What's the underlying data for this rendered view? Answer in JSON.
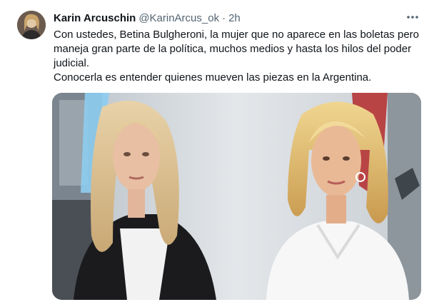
{
  "tweet": {
    "author_name": "Karin Arcuschin",
    "handle": "@KarinArcus_ok",
    "separator": "·",
    "time": "2h",
    "more_icon": "more-horizontal-icon",
    "text": [
      "Con ustedes, Betina Bulgheroni, la mujer que no aparece en las boletas pero maneja gran parte de la política, muchos medios y hasta los hilos del poder judicial.",
      "Conocerla es entender quienes mueven las piezas en la Argentina."
    ]
  }
}
